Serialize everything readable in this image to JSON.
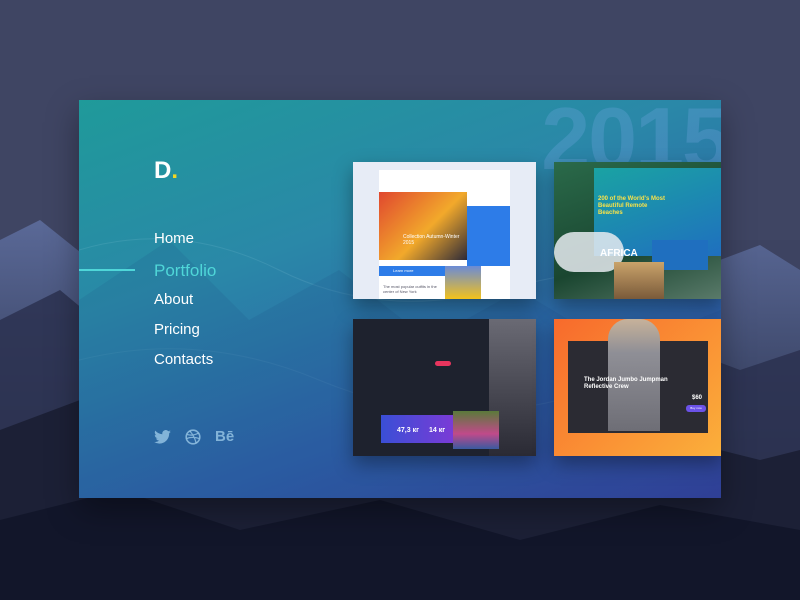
{
  "brand": {
    "logo_letter": "D",
    "logo_dot": ".",
    "accent": "#4fd6d8",
    "dot_color": "#f3d623"
  },
  "watermark": {
    "year": "2015"
  },
  "nav": {
    "items": [
      {
        "label": "Home"
      },
      {
        "label": "Portfolio",
        "active": true
      },
      {
        "label": "About"
      },
      {
        "label": "Pricing"
      },
      {
        "label": "Contacts"
      }
    ]
  },
  "social": {
    "icons": [
      "twitter-icon",
      "dribbble-icon",
      "behance-icon"
    ],
    "behance_text": "Bē"
  },
  "thumbs": {
    "t1": {
      "title": "Collection Autumn-Winter 2015",
      "button": "Learn more",
      "caption": "The most popular outfits in the center of New York"
    },
    "t2": {
      "title": "200 of the World's Most Beautiful Remote Beaches",
      "region": "AFRICA"
    },
    "t3": {
      "stat1": "47,3 кг",
      "stat2": "14 кг"
    },
    "t4": {
      "title": "The Jordan Jumbo Jumpman Reflective Crew",
      "price": "$60",
      "buy": "Buy now"
    }
  }
}
